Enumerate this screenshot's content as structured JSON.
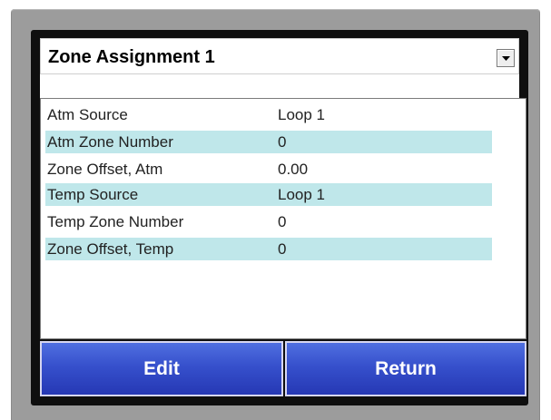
{
  "dropdown": {
    "selected": "Zone Assignment 1",
    "icon": "chevron-down-icon"
  },
  "settings": [
    {
      "label": "Atm Source",
      "value": "Loop 1",
      "highlighted": false
    },
    {
      "label": "Atm Zone Number",
      "value": "0",
      "highlighted": true
    },
    {
      "label": "Zone Offset, Atm",
      "value": "0.00",
      "highlighted": false
    },
    {
      "label": "Temp Source",
      "value": "Loop 1",
      "highlighted": true
    },
    {
      "label": "Temp Zone Number",
      "value": "0",
      "highlighted": false
    },
    {
      "label": "Zone Offset, Temp",
      "value": "0",
      "highlighted": true
    }
  ],
  "buttons": {
    "edit_label": "Edit",
    "return_label": "Return"
  },
  "colors": {
    "row_highlight": "#bfe7ea",
    "button_blue": "#3650cc",
    "bezel": "#9c9c9c",
    "screen_frame": "#0f0f0f"
  }
}
